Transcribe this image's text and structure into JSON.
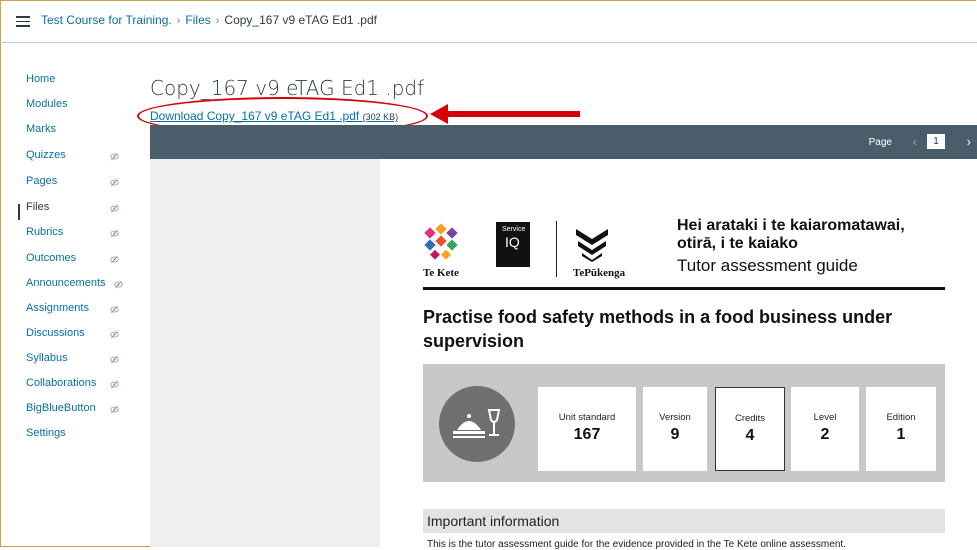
{
  "breadcrumb": {
    "course": "Test Course for Training.",
    "files": "Files",
    "current": "Copy_167 v9 eTAG Ed1 .pdf"
  },
  "sidebar": {
    "items": [
      {
        "label": "Home",
        "hidden_icon": false
      },
      {
        "label": "Modules",
        "hidden_icon": false
      },
      {
        "label": "Marks",
        "hidden_icon": false
      },
      {
        "label": "Quizzes",
        "hidden_icon": true
      },
      {
        "label": "Pages",
        "hidden_icon": true
      },
      {
        "label": "Files",
        "hidden_icon": true,
        "active": true
      },
      {
        "label": "Rubrics",
        "hidden_icon": true
      },
      {
        "label": "Outcomes",
        "hidden_icon": true
      },
      {
        "label": "Announcements",
        "hidden_icon": true
      },
      {
        "label": "Assignments",
        "hidden_icon": true
      },
      {
        "label": "Discussions",
        "hidden_icon": true
      },
      {
        "label": "Syllabus",
        "hidden_icon": true
      },
      {
        "label": "Collaborations",
        "hidden_icon": true
      },
      {
        "label": "BigBlueButton",
        "hidden_icon": true
      },
      {
        "label": "Settings",
        "hidden_icon": false
      }
    ]
  },
  "main": {
    "title": "Copy_167 v9 eTAG Ed1 .pdf",
    "download_label": "Download Copy_167 v9 eTAG Ed1 .pdf",
    "download_size": "(302 KB)"
  },
  "viewer": {
    "page_label": "Page",
    "page_number": "1",
    "prev_icon": "chevron-left-icon",
    "next_icon": "chevron-right-icon"
  },
  "pdf": {
    "te_kete": "Te Kete",
    "service_iq_small": "Service",
    "service_iq_big": "IQ",
    "te_pukenga": "TePūkenga",
    "hei_arataki_line1": "Hei arataki i te kaiaromatawai,",
    "hei_arataki_line2": "otirā, i te kaiako",
    "guide_title": "Tutor assessment guide",
    "heading": "Practise food safety methods in a food business under supervision",
    "cards": [
      {
        "label": "Unit standard",
        "value": "167"
      },
      {
        "label": "Version",
        "value": "9"
      },
      {
        "label": "Credits",
        "value": "4"
      },
      {
        "label": "Level",
        "value": "2"
      },
      {
        "label": "Edition",
        "value": "1"
      }
    ],
    "important_heading": "Important information",
    "important_text": "This is the tutor assessment guide for the evidence provided in the Te Kete online assessment."
  },
  "colors": {
    "link": "#0770a3",
    "annotation_red": "#d6000a",
    "toolbar": "#4a5d6b",
    "frame_border": "#c8a24a"
  }
}
